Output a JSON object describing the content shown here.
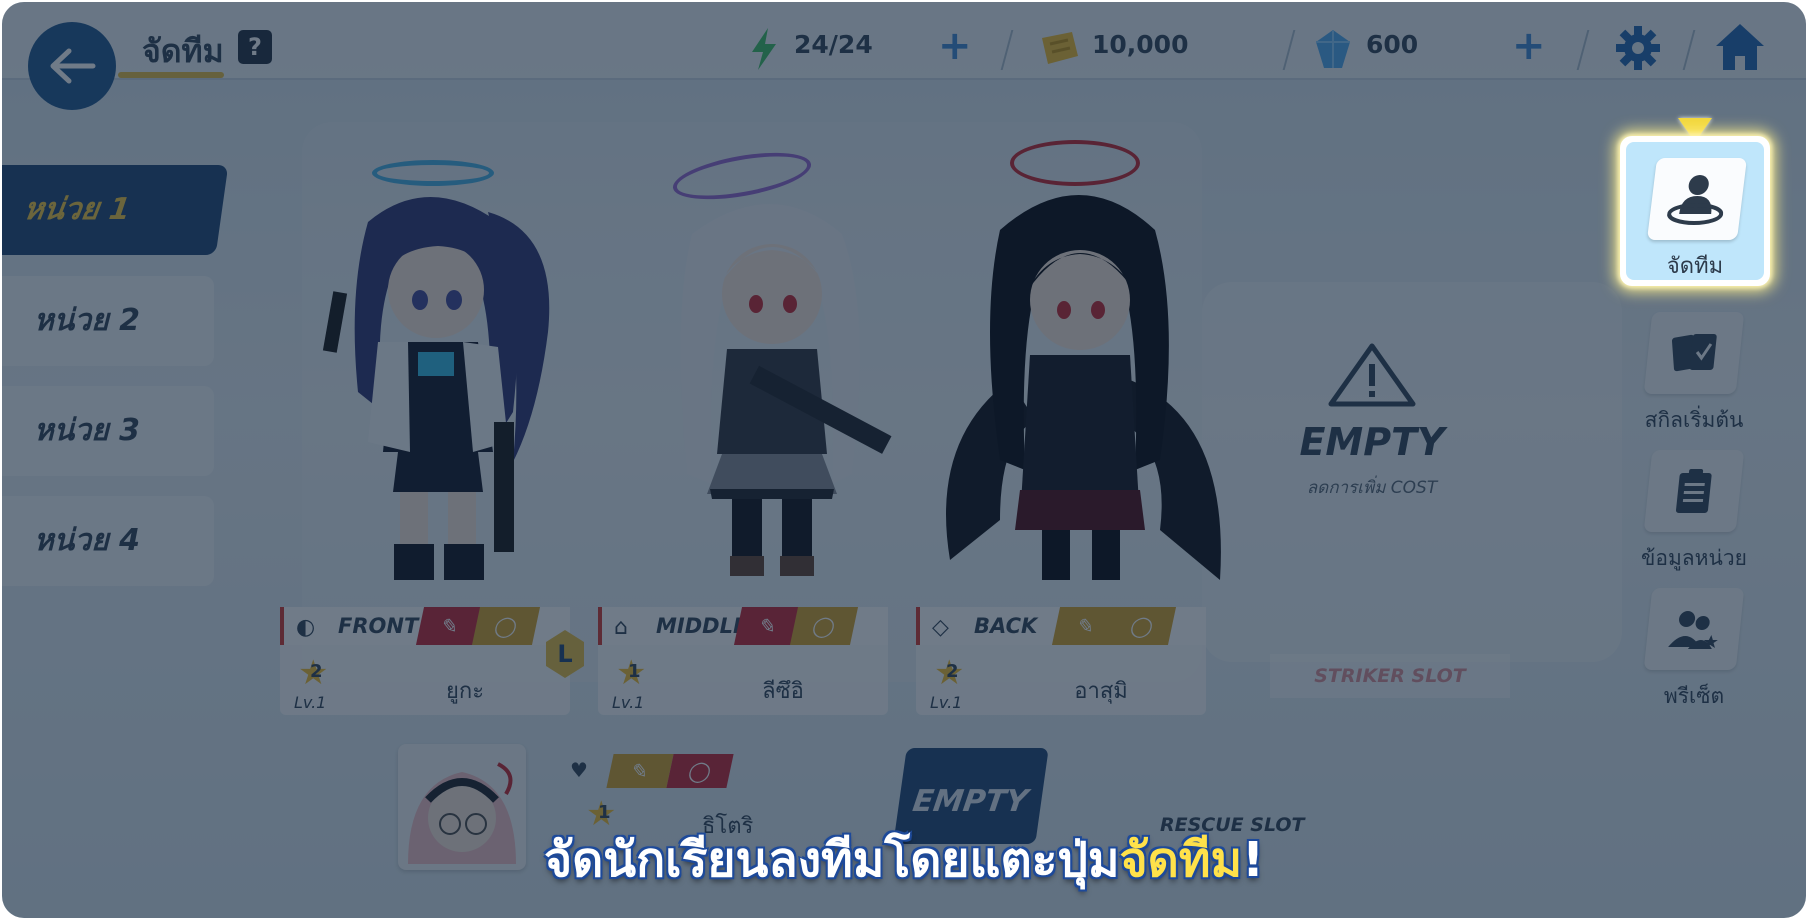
{
  "header": {
    "title": "จัดทีม",
    "help_icon": "question-icon",
    "ap": "24/24",
    "credits": "10,000",
    "pyroxene": "600",
    "icons": [
      "back-arrow-icon",
      "lightning-icon",
      "credit-ticket-icon",
      "pyroxene-gem-icon",
      "plus-icon",
      "gear-icon",
      "home-icon"
    ]
  },
  "tabs": [
    {
      "label": "หน่วย 1",
      "active": true
    },
    {
      "label": "หน่วย 2",
      "active": false
    },
    {
      "label": "หน่วย 3",
      "active": false
    },
    {
      "label": "หน่วย 4",
      "active": false
    }
  ],
  "members": [
    {
      "position": "FRONT",
      "stars": "2",
      "level": "Lv.1",
      "name": "ยูกะ",
      "leader_badge": "L"
    },
    {
      "position": "MIDDLE",
      "stars": "1",
      "level": "Lv.1",
      "name": "ลีซึอิ"
    },
    {
      "position": "BACK",
      "stars": "2",
      "level": "Lv.1",
      "name": "อาสุมิ"
    }
  ],
  "empty_slot": {
    "title": "EMPTY",
    "subtitle": "ลดการเพิ่ม COST",
    "striker_slot": "STRIKER SLOT"
  },
  "support": {
    "stars": "1",
    "name": "ธิโตริ",
    "empty_label": "EMPTY",
    "rescue_label": "RESCUE SLOT"
  },
  "right_menu": {
    "highlighted": {
      "label": "จัดทีม",
      "icon": "team-member-icon"
    },
    "items": [
      {
        "label": "สกิลเริ่มต้น",
        "icon": "skill-cards-icon"
      },
      {
        "label": "ข้อมูลหน่วย",
        "icon": "clipboard-icon"
      },
      {
        "label": "พรีเซ็ต",
        "icon": "preset-users-icon"
      }
    ]
  },
  "caption": {
    "text": "จัดนักเรียนลงทีมโดยแตะปุ่ม",
    "highlight": "จัดทีม",
    "suffix": "!"
  },
  "colors": {
    "accent_yellow": "#ffe14a",
    "active_tab": "#2b4f7d",
    "highlight_bg": "#bfe6fb",
    "overlay": "rgba(8,28,50,0.58)"
  }
}
